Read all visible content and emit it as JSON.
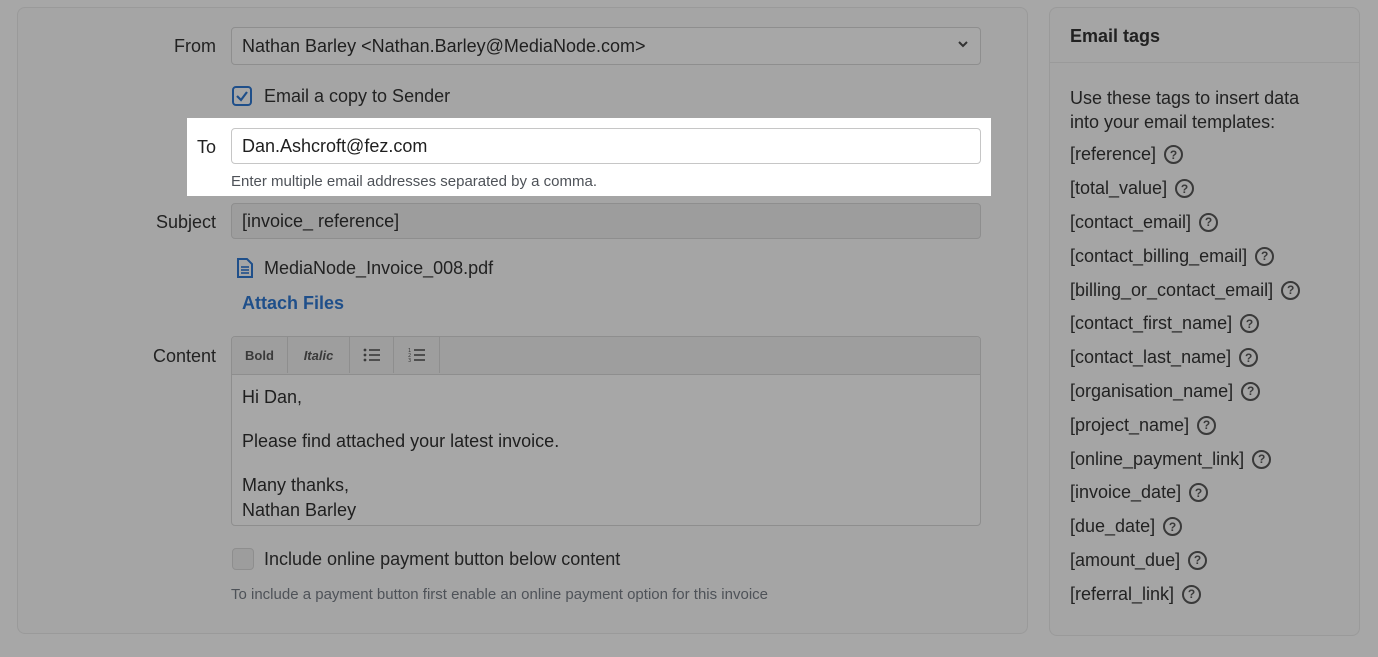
{
  "form": {
    "from_label": "From",
    "from_value": "Nathan Barley <Nathan.Barley@MediaNode.com>",
    "copy_label": "Email a copy to Sender",
    "to_label": "To",
    "to_value": "Dan.Ashcroft@fez.com",
    "to_hint": "Enter multiple email addresses separated by a comma.",
    "subject_label": "Subject",
    "subject_value": "[invoice_ reference]",
    "attachment_name": "MediaNode_Invoice_008.pdf",
    "attach_files_label": "Attach Files",
    "content_label": "Content",
    "toolbar": {
      "bold": "Bold",
      "italic": "Italic"
    },
    "content": {
      "greeting": "Hi Dan,",
      "line1": "Please find attached your latest invoice.",
      "signoff": "Many thanks,",
      "name": "Nathan Barley"
    },
    "payment_label": "Include online payment button below content",
    "payment_hint": "To include a payment button first enable an online payment option for this invoice"
  },
  "sidebar": {
    "title": "Email tags",
    "description": "Use these tags to insert data into your email templates:",
    "tags": [
      "[reference]",
      "[total_value]",
      "[contact_email]",
      "[contact_billing_email]",
      "[billing_or_contact_email]",
      "[contact_first_name]",
      "[contact_last_name]",
      "[organisation_name]",
      "[project_name]",
      "[online_payment_link]",
      "[invoice_date]",
      "[due_date]",
      "[amount_due]",
      "[referral_link]"
    ]
  },
  "colors": {
    "accent": "#1f4f8a",
    "overlay": "#a7a7a7",
    "highlight": "#ffffff"
  }
}
